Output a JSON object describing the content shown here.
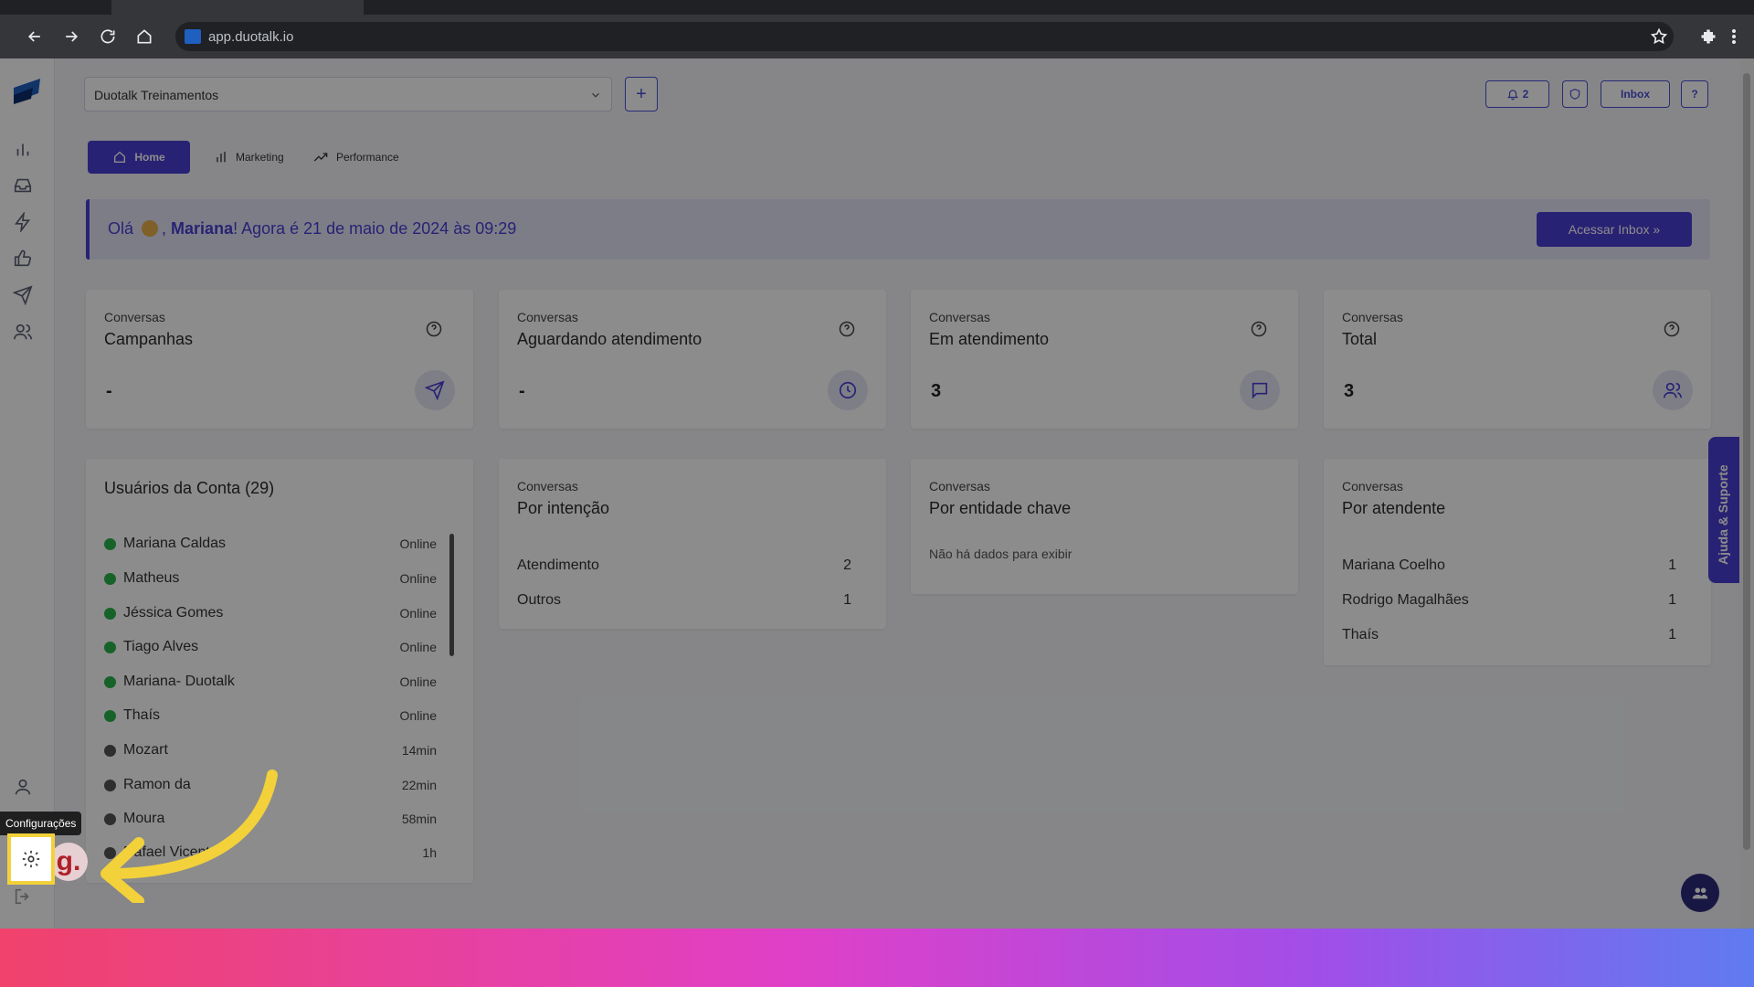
{
  "browser": {
    "url": "app.duotalk.io"
  },
  "header": {
    "company": "Duotalk Treinamentos",
    "add_label": "+",
    "notifications_count": "2",
    "inbox_label": "Inbox",
    "help_label": "?"
  },
  "tabs": [
    {
      "label": "Home"
    },
    {
      "label": "Marketing"
    },
    {
      "label": "Performance"
    }
  ],
  "banner": {
    "prefix": "Olá",
    "name": "Mariana",
    "suffix": "! Agora é 21 de maio de 2024 às 09:29",
    "cta": "Acessar Inbox »"
  },
  "stats": [
    {
      "kicker": "Conversas",
      "title": "Campanhas",
      "value": "-",
      "icon": "send-icon"
    },
    {
      "kicker": "Conversas",
      "title": "Aguardando atendimento",
      "value": "-",
      "icon": "clock-icon"
    },
    {
      "kicker": "Conversas",
      "title": "Em atendimento",
      "value": "3",
      "icon": "chat-icon"
    },
    {
      "kicker": "Conversas",
      "title": "Total",
      "value": "3",
      "icon": "users-icon"
    }
  ],
  "users": {
    "title": "Usuários da Conta (29)",
    "items": [
      {
        "name": "Mariana Caldas",
        "status": "Online",
        "online": true
      },
      {
        "name": "Matheus",
        "status": "Online",
        "online": true
      },
      {
        "name": "Jéssica Gomes",
        "status": "Online",
        "online": true
      },
      {
        "name": "Tiago Alves",
        "status": "Online",
        "online": true
      },
      {
        "name": "Mariana- Duotalk",
        "status": "Online",
        "online": true
      },
      {
        "name": "Thaís",
        "status": "Online",
        "online": true
      },
      {
        "name": "Mozart",
        "status": "14min",
        "online": false
      },
      {
        "name": "Ramon da",
        "status": "22min",
        "online": false
      },
      {
        "name": "Moura",
        "status": "58min",
        "online": false
      },
      {
        "name": "Rafael Vicente",
        "status": "1h",
        "online": false
      }
    ]
  },
  "intencao": {
    "kicker": "Conversas",
    "title": "Por intenção",
    "rows": [
      {
        "label": "Atendimento",
        "value": "2"
      },
      {
        "label": "Outros",
        "value": "1"
      }
    ]
  },
  "entidade": {
    "kicker": "Conversas",
    "title": "Por entidade chave",
    "empty": "Não há dados para exibir"
  },
  "atendente": {
    "kicker": "Conversas",
    "title": "Por atendente",
    "rows": [
      {
        "label": "Mariana Coelho",
        "value": "1"
      },
      {
        "label": "Rodrigo Magalhães",
        "value": "1"
      },
      {
        "label": "Thaís",
        "value": "1"
      }
    ]
  },
  "help_tab": "Ajuda & Suporte",
  "tooltip": "Configurações",
  "avatar_letter": "g.",
  "colors": {
    "accent": "#4a3fd4",
    "highlight": "#f3d13a",
    "online": "#2bb24c"
  }
}
